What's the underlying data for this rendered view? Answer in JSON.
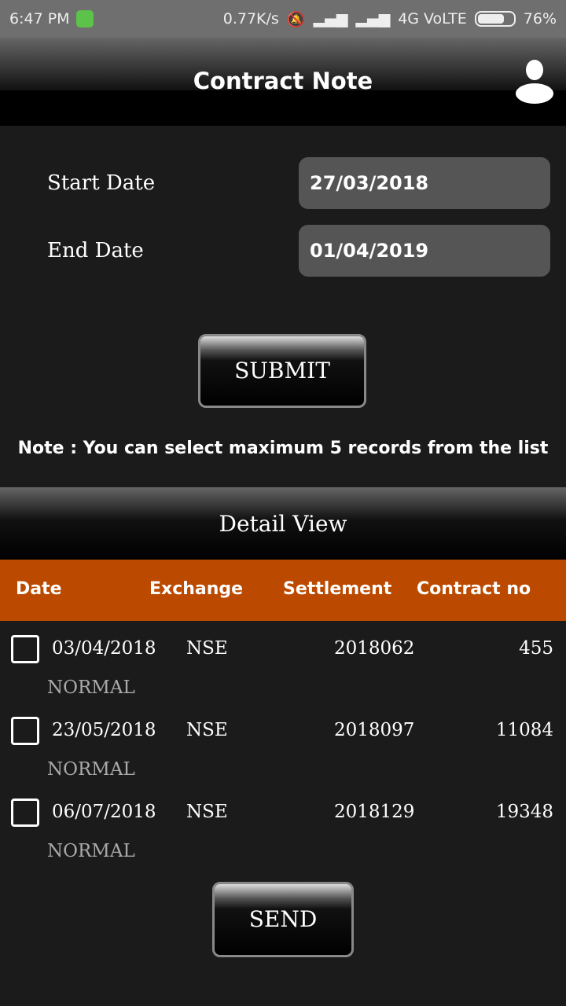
{
  "status": {
    "time": "6:47 PM",
    "speed": "0.77K/s",
    "network": "4G VoLTE",
    "battery": "76%",
    "battery_level": 0.76
  },
  "header": {
    "title": "Contract Note"
  },
  "form": {
    "start_label": "Start Date",
    "start_value": "27/03/2018",
    "end_label": "End Date",
    "end_value": "01/04/2019",
    "submit": "SUBMIT"
  },
  "note": "Note : You can select maximum 5 records from the list",
  "detail_title": "Detail View",
  "table": {
    "headers": [
      "Date",
      "Exchange",
      "Settlement",
      "Contract no"
    ],
    "rows": [
      {
        "date": "03/04/2018",
        "exchange": "NSE",
        "settlement": "2018062",
        "contract": "455",
        "type": "NORMAL",
        "checked": false
      },
      {
        "date": "23/05/2018",
        "exchange": "NSE",
        "settlement": "2018097",
        "contract": "11084",
        "type": "NORMAL",
        "checked": false
      },
      {
        "date": "06/07/2018",
        "exchange": "NSE",
        "settlement": "2018129",
        "contract": "19348",
        "type": "NORMAL",
        "checked": false
      }
    ]
  },
  "send": "SEND",
  "colors": {
    "header_bar": "#bb4a00",
    "background": "#1b1b1b"
  }
}
